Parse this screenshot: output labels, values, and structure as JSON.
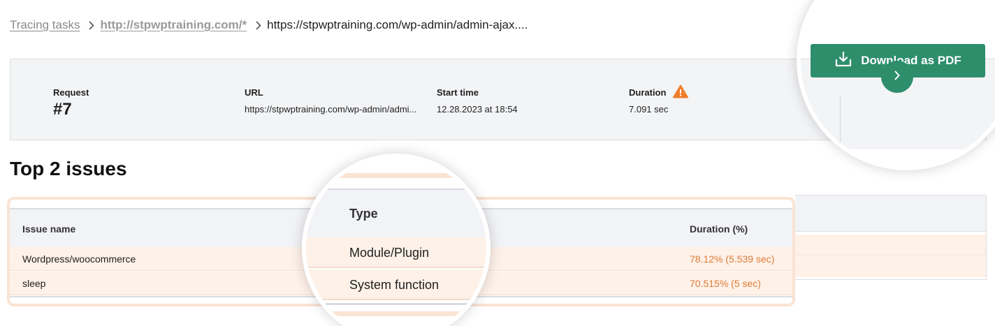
{
  "breadcrumb": {
    "items": [
      {
        "label": "Tracing tasks"
      },
      {
        "label": "http://stpwptraining.com/*"
      },
      {
        "label": "https://stpwptraining.com/wp-admin/admin-ajax...."
      }
    ]
  },
  "summary": {
    "request_label": "Request",
    "request_value": "#7",
    "url_label": "URL",
    "url_value": "https://stpwptraining.com/wp-admin/admi...",
    "start_label": "Start time",
    "start_value": "12.28.2023 at 18:54",
    "duration_label": "Duration",
    "duration_value": "7.091 sec",
    "duration_warning_icon": "warning-triangle-icon"
  },
  "actions": {
    "download_label": "Download as PDF",
    "download_icon": "download-icon",
    "prev_icon": "chevron-left-icon",
    "next_icon": "chevron-right-icon"
  },
  "issues": {
    "title": "Top 2 issues",
    "columns": {
      "name": "Issue name",
      "type": "Type",
      "duration": "Duration (%)"
    },
    "rows": [
      {
        "name": "Wordpress/woocommerce",
        "type": "Module/Plugin",
        "duration": "78.12% (5.539 sec)"
      },
      {
        "name": "sleep",
        "type": "System function",
        "duration": "70.515% (5 sec)"
      }
    ]
  },
  "colors": {
    "accent_green": "#2e8e6c",
    "warning_orange": "#f07d2a",
    "duration_text": "#e07b36",
    "row_highlight": "#fdf1e8"
  }
}
